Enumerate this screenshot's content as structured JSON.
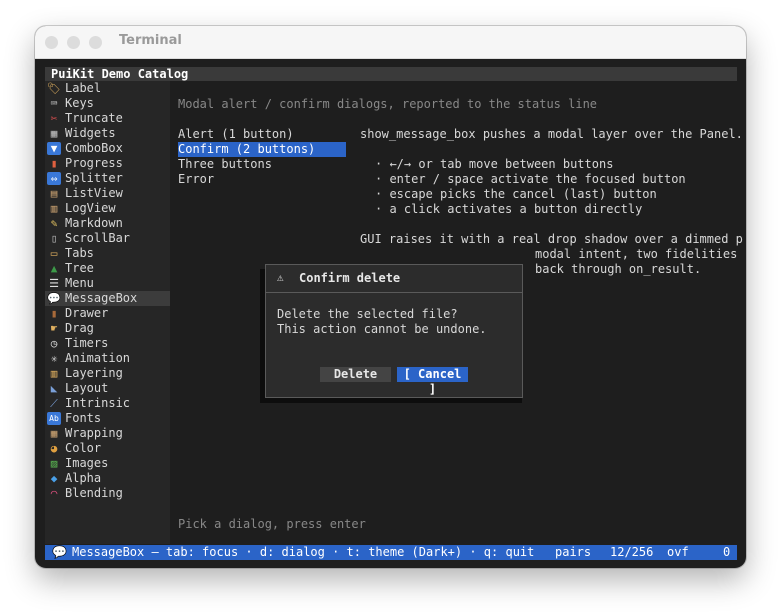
{
  "window": {
    "title": "Terminal"
  },
  "app": {
    "title": "PuiKit Demo Catalog"
  },
  "sidebar": {
    "items": [
      {
        "label": "Label",
        "icon": "🏷"
      },
      {
        "label": "Keys",
        "icon": "⌨"
      },
      {
        "label": "Truncate",
        "icon": "✂"
      },
      {
        "label": "Widgets",
        "icon": "▦"
      },
      {
        "label": "ComboBox",
        "icon": "▼"
      },
      {
        "label": "Progress",
        "icon": "▮"
      },
      {
        "label": "Splitter",
        "icon": "⇔"
      },
      {
        "label": "ListView",
        "icon": "▤"
      },
      {
        "label": "LogView",
        "icon": "▥"
      },
      {
        "label": "Markdown",
        "icon": "✎"
      },
      {
        "label": "ScrollBar",
        "icon": "▯"
      },
      {
        "label": "Tabs",
        "icon": "▭"
      },
      {
        "label": "Tree",
        "icon": "▲"
      },
      {
        "label": "Menu",
        "icon": "☰"
      },
      {
        "label": "MessageBox",
        "icon": "💬"
      },
      {
        "label": "Drawer",
        "icon": "▮"
      },
      {
        "label": "Drag",
        "icon": "☛"
      },
      {
        "label": "Timers",
        "icon": "◷"
      },
      {
        "label": "Animation",
        "icon": "✳"
      },
      {
        "label": "Layering",
        "icon": "▥"
      },
      {
        "label": "Layout",
        "icon": "◣"
      },
      {
        "label": "Intrinsic",
        "icon": "⟋"
      },
      {
        "label": "Fonts",
        "icon": "Ab"
      },
      {
        "label": "Wrapping",
        "icon": "▦"
      },
      {
        "label": "Color",
        "icon": "◕"
      },
      {
        "label": "Images",
        "icon": "▨"
      },
      {
        "label": "Alpha",
        "icon": "◆"
      },
      {
        "label": "Blending",
        "icon": "◠"
      }
    ]
  },
  "content": {
    "header": "Modal alert / confirm dialogs, reported to the status line",
    "dialogs": [
      {
        "label": "Alert (1 button)"
      },
      {
        "label": "Confirm (2 buttons)"
      },
      {
        "label": "Three buttons"
      },
      {
        "label": "Error"
      }
    ],
    "description": {
      "line1": "show_message_box pushes a modal layer over the Panel.",
      "bullet1": "· ←/→ or tab move between buttons",
      "bullet2": "· enter / space activate the focused button",
      "bullet3": "· escape picks the cancel (last) button",
      "bullet4": "· a click activates a button directly",
      "gui_line": "GUI raises it with a real drop shadow over a dimmed p",
      "modal_line": "modal intent, two fidelities",
      "result_line": "back through on_result."
    },
    "footer_hint": "Pick a dialog, press enter"
  },
  "modal": {
    "icon": "⚠",
    "title": "Confirm delete",
    "message_line1": "Delete the selected file?",
    "message_line2": "This action cannot be undone.",
    "delete_label": "Delete",
    "cancel_label": "[ Cancel ]"
  },
  "statusbar": {
    "icon": "💬",
    "text": "MessageBox — tab: focus · d: dialog · t: theme (Dark+) · q: quit",
    "pairs_label": "pairs",
    "count": "12/256",
    "ovf_label": "ovf",
    "ovf_value": "0"
  },
  "colors": {
    "accent": "#2b64c8",
    "background": "#1e1e1e",
    "sidebar": "#262626"
  }
}
